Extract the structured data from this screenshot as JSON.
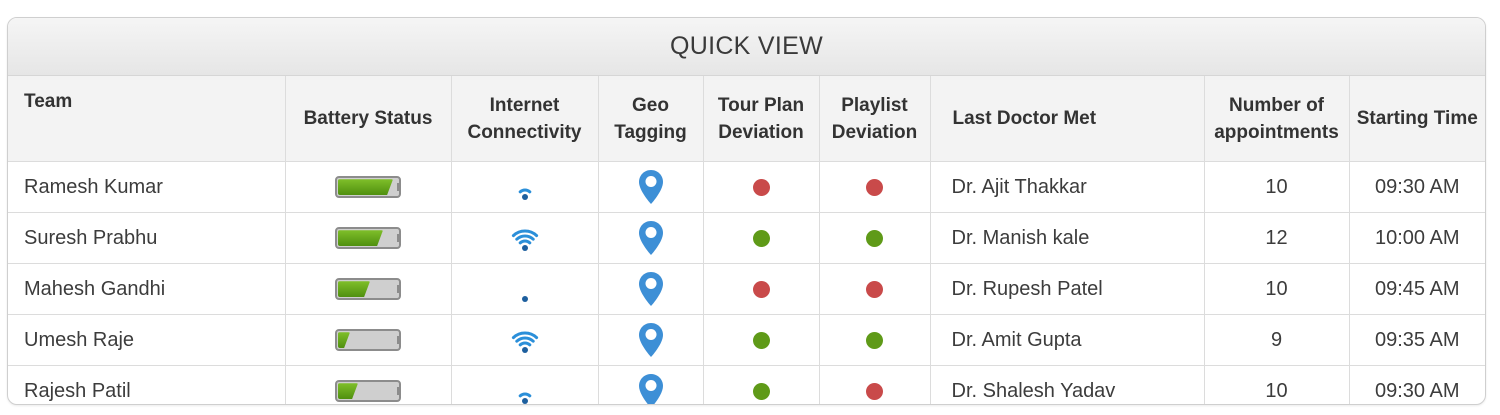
{
  "title": "QUICK VIEW",
  "colors": {
    "green": "#5f9a18",
    "red": "#c94a4a",
    "wifi": "#2b8fd9",
    "pin": "#3d8fd6"
  },
  "columns": [
    {
      "label": "Team"
    },
    {
      "label": "Battery Status"
    },
    {
      "label": "Internet Connectivity"
    },
    {
      "label": "Geo Tagging"
    },
    {
      "label": "Tour Plan Deviation"
    },
    {
      "label": "Playlist Deviation"
    },
    {
      "label": "Last Doctor Met"
    },
    {
      "label": "Number of appointments"
    },
    {
      "label": "Starting Time"
    }
  ],
  "rows": [
    {
      "team": "Ramesh Kumar",
      "battery": 0.95,
      "wifi_bars": 2,
      "geo": "map-pin-icon",
      "tour": "red",
      "playlist": "red",
      "doctor": "Dr. Ajit Thakkar",
      "appointments": "10",
      "time": "09:30 AM"
    },
    {
      "team": "Suresh Prabhu",
      "battery": 0.78,
      "wifi_bars": 4,
      "geo": "map-pin-icon",
      "tour": "green",
      "playlist": "green",
      "doctor": "Dr. Manish kale",
      "appointments": "12",
      "time": "10:00 AM"
    },
    {
      "team": "Mahesh Gandhi",
      "battery": 0.55,
      "wifi_bars": 1,
      "geo": "map-pin-icon",
      "tour": "red",
      "playlist": "red",
      "doctor": "Dr. Rupesh Patel",
      "appointments": "10",
      "time": "09:45 AM"
    },
    {
      "team": "Umesh Raje",
      "battery": 0.2,
      "wifi_bars": 4,
      "geo": "map-pin-icon",
      "tour": "green",
      "playlist": "green",
      "doctor": "Dr. Amit Gupta",
      "appointments": "9",
      "time": "09:35 AM"
    },
    {
      "team": "Rajesh Patil",
      "battery": 0.35,
      "wifi_bars": 2,
      "geo": "map-pin-icon",
      "tour": "green",
      "playlist": "red",
      "doctor": "Dr. Shalesh Yadav",
      "appointments": "10",
      "time": "09:30 AM"
    }
  ]
}
